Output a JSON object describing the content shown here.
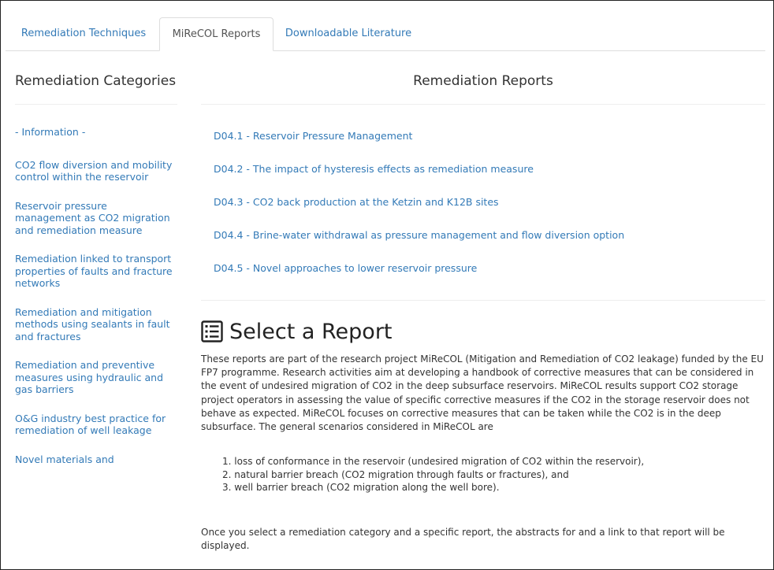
{
  "tabs": [
    {
      "label": "Remediation Techniques",
      "active": false
    },
    {
      "label": "MiReCOL Reports",
      "active": true
    },
    {
      "label": "Downloadable Literature",
      "active": false
    }
  ],
  "left": {
    "title": "Remediation Categories",
    "items": [
      "- Information -",
      "CO2 flow diversion and mobility control within the reservoir",
      "Reservoir pressure management as CO2 migration and remediation measure",
      "Remediation linked to transport properties of faults and fracture networks",
      "Remediation and mitigation methods using sealants in fault and fractures",
      "Remediation and preventive measures using hydraulic and gas barriers",
      "O&G industry best practice for remediation of well leakage",
      "Novel materials and"
    ]
  },
  "right": {
    "title": "Remediation Reports",
    "reports": [
      "D04.1 - Reservoir Pressure Management",
      "D04.2 - The impact of hysteresis effects as remediation measure",
      "D04.3 - CO2 back production at the Ketzin and K12B sites",
      "D04.4 - Brine-water withdrawal as pressure management and flow diversion option",
      "D04.5 - Novel approaches to lower reservoir pressure"
    ],
    "select_heading": "Select a Report",
    "intro": "These reports are part of the research project MiReCOL (Mitigation and Remediation of CO2 leakage) funded by the EU FP7 programme. Research activities aim at developing a handbook of corrective measures that can be considered in the event of undesired migration of CO2 in the deep subsurface reservoirs. MiReCOL results support CO2 storage project operators in assessing the value of specific corrective measures if the CO2 in the storage reservoir does not behave as expected. MiReCOL focuses on corrective measures that can be taken while the CO2 is in the deep subsurface. The general scenarios considered in MiReCOL are",
    "scenarios": [
      "1. loss of conformance in the reservoir (undesired migration of CO2 within the reservoir),",
      "2. natural barrier breach (CO2 migration through faults or fractures), and",
      "3. well barrier breach (CO2 migration along the well bore)."
    ],
    "outro": "Once you select a remediation category and a specific report, the abstracts for and a link to that report will be displayed."
  },
  "colors": {
    "link": "#337ab7",
    "text": "#333333",
    "border": "#dddddd"
  },
  "icons": {
    "select_heading": "list-alt-icon"
  }
}
